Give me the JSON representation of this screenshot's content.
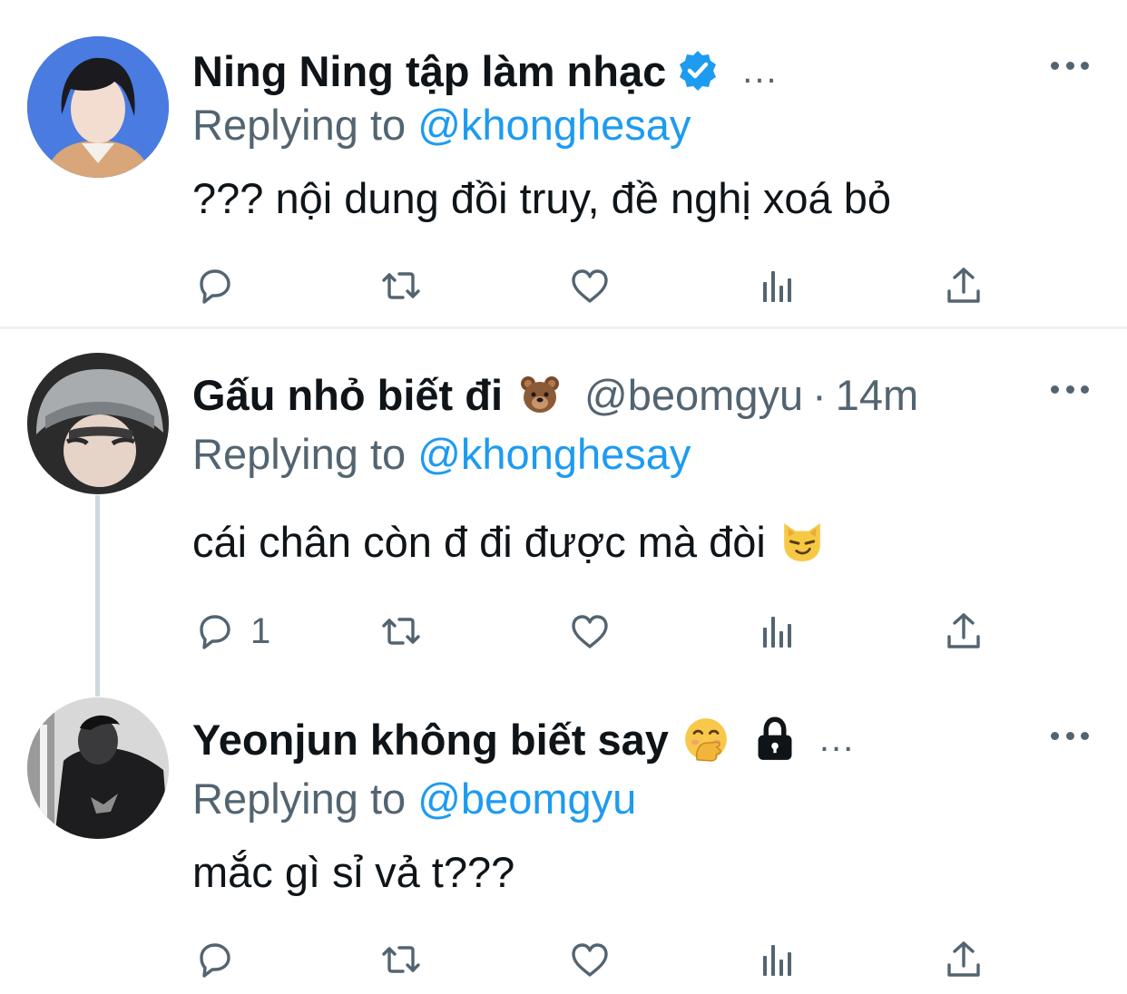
{
  "tweets": [
    {
      "display_name": "Ning Ning tập làm nhạc",
      "verified": true,
      "more_after_name": "...",
      "replying_prefix": "Replying to",
      "replying_to": "@khonghesay",
      "text": "??? nội dung đồi truy, đề nghị xoá bỏ",
      "reply_count": ""
    },
    {
      "display_name": "Gấu nhỏ biết đi",
      "name_emoji": "bear-face-emoji",
      "handle": "@beomgyu",
      "separator": "·",
      "time": "14m",
      "replying_prefix": "Replying to",
      "replying_to": "@khonghesay",
      "text": "cái chân còn đ đi được mà đòi",
      "text_emoji": "smirking-cat-emoji",
      "reply_count": "1"
    },
    {
      "display_name": "Yeonjun không biết say",
      "name_emoji": "hand-over-mouth-emoji",
      "protected": true,
      "more_after_name": "...",
      "replying_prefix": "Replying to",
      "replying_to": "@beomgyu",
      "text": "mắc gì sỉ vả t???",
      "reply_count": ""
    }
  ],
  "icons": [
    "reply-icon",
    "retweet-icon",
    "like-icon",
    "analytics-icon",
    "share-icon",
    "more-icon",
    "verified-badge-icon",
    "lock-icon"
  ],
  "colors": {
    "link": "#1d9bf0",
    "secondary": "#536471",
    "primary": "#0f1419",
    "verified": "#1d9bf0"
  }
}
